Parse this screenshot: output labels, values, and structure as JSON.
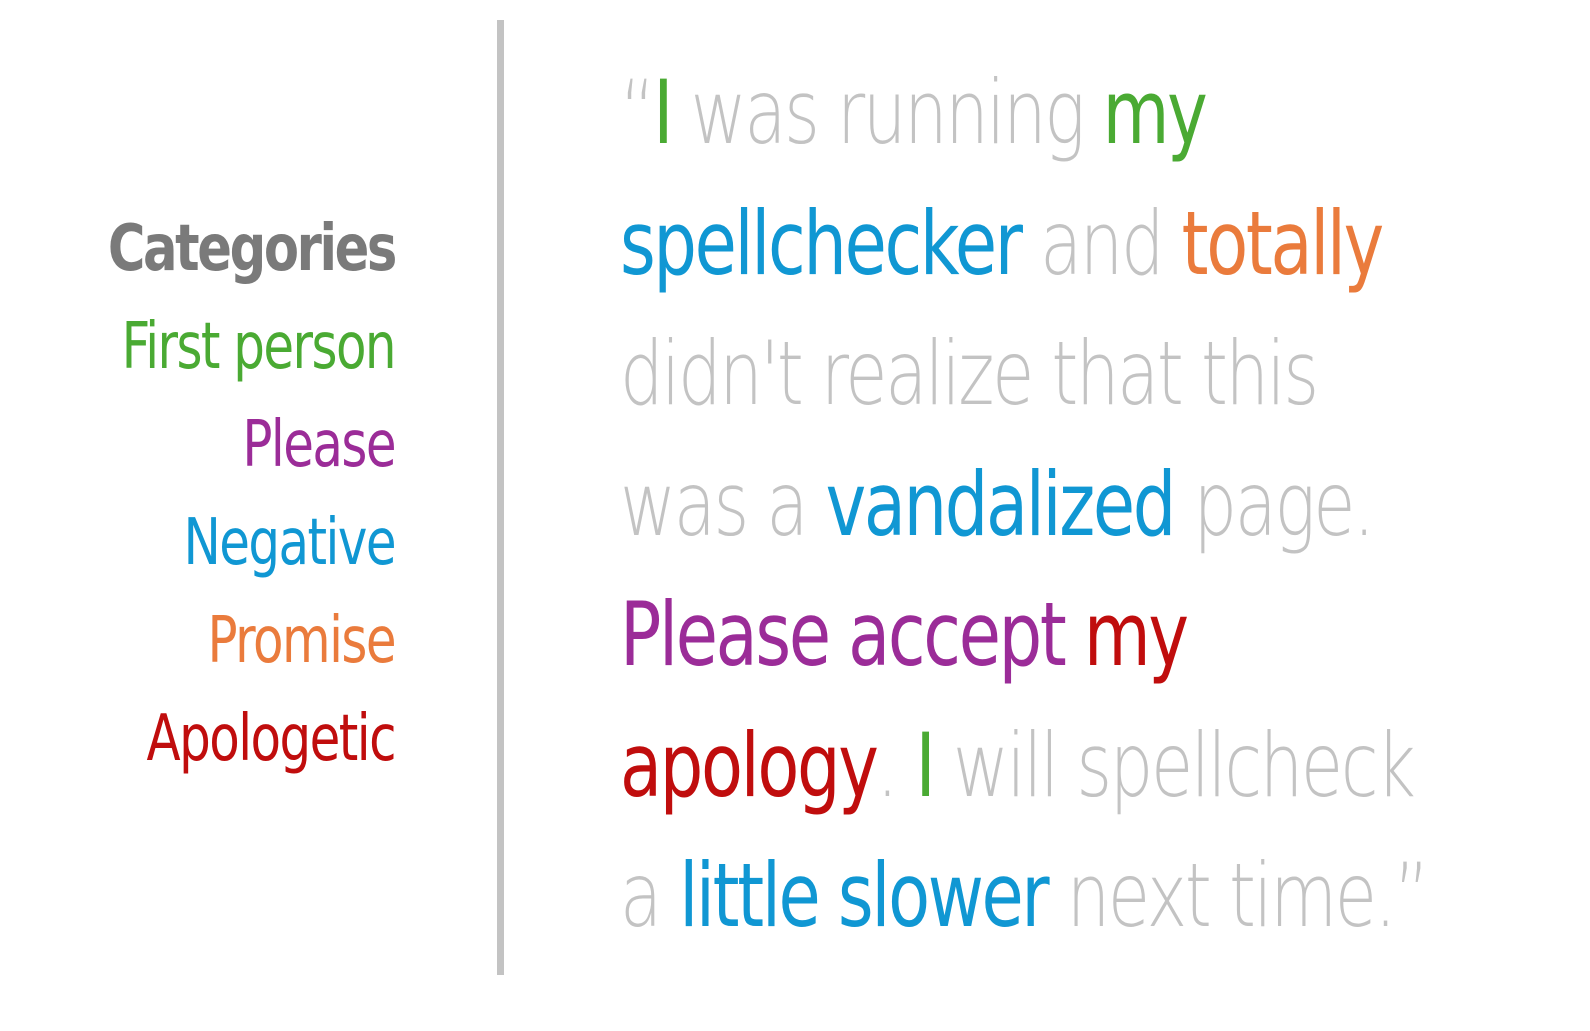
{
  "colors": {
    "title": "#7a7a7a",
    "neutral": "#c3c3c3",
    "first_person": "#4aaa33",
    "please": "#9b2c98",
    "negative": "#1097d3",
    "promise": "#ea7b3c",
    "apologetic": "#c00d0d",
    "divider": "#c3c3c3"
  },
  "legend": {
    "title": "Categories",
    "items": [
      {
        "label": "First person",
        "category": "first_person"
      },
      {
        "label": "Please",
        "category": "please"
      },
      {
        "label": "Negative",
        "category": "negative"
      },
      {
        "label": "Promise",
        "category": "promise"
      },
      {
        "label": "Apologetic",
        "category": "apologetic"
      }
    ]
  },
  "quote": {
    "lines": [
      [
        {
          "text": "“",
          "category": "neutral"
        },
        {
          "text": "I",
          "category": "first_person"
        },
        {
          "text": " was running ",
          "category": "neutral"
        },
        {
          "text": "my",
          "category": "first_person"
        }
      ],
      [
        {
          "text": "spellchecker",
          "category": "negative"
        },
        {
          "text": " and ",
          "category": "neutral"
        },
        {
          "text": "totally",
          "category": "promise"
        }
      ],
      [
        {
          "text": "didn't realize that this",
          "category": "neutral"
        }
      ],
      [
        {
          "text": "was a ",
          "category": "neutral"
        },
        {
          "text": "vandalized",
          "category": "negative"
        },
        {
          "text": " page.",
          "category": "neutral"
        }
      ],
      [
        {
          "text": "Please accept",
          "category": "please"
        },
        {
          "text": " ",
          "category": "neutral"
        },
        {
          "text": "my",
          "category": "apologetic"
        }
      ],
      [
        {
          "text": "apology",
          "category": "apologetic"
        },
        {
          "text": ". ",
          "category": "neutral"
        },
        {
          "text": "I",
          "category": "first_person"
        },
        {
          "text": " will spellcheck",
          "category": "neutral"
        }
      ],
      [
        {
          "text": "a ",
          "category": "neutral"
        },
        {
          "text": "little slower",
          "category": "negative"
        },
        {
          "text": " next time.”",
          "category": "neutral"
        }
      ]
    ]
  }
}
